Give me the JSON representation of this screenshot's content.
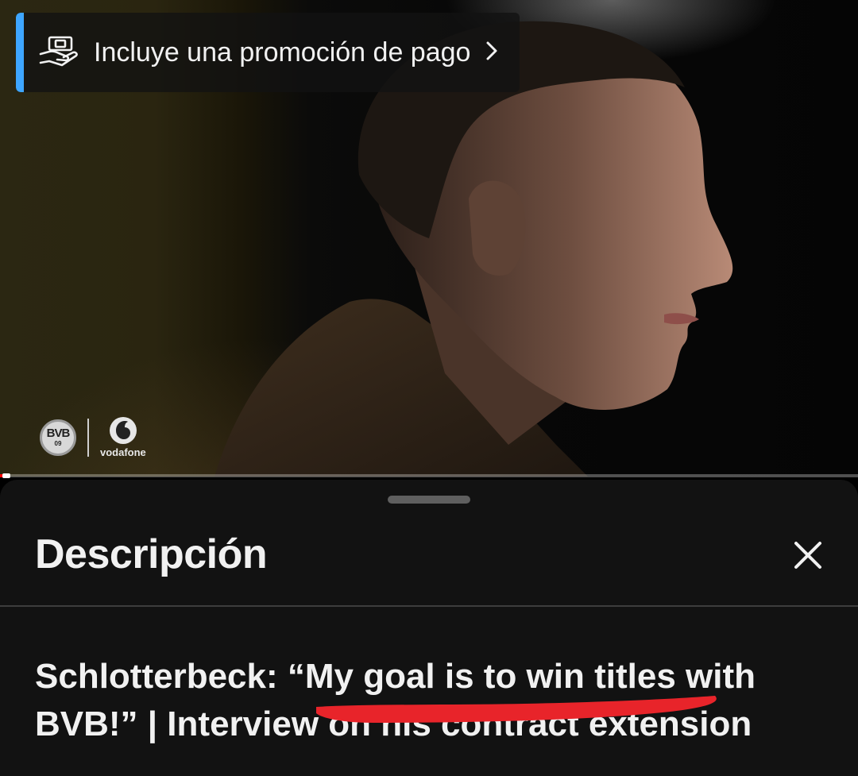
{
  "promo": {
    "label": "Incluye una promoción de pago",
    "icon": "payment-icon",
    "accent_color": "#3ea6ff"
  },
  "video": {
    "watermark": {
      "club_logo": "BVB 09",
      "sponsor": "vodafone"
    },
    "progress_fraction": 0.005
  },
  "description_panel": {
    "title": "Descripción",
    "close_icon": "close-icon",
    "video_title": "Schlotterbeck: “My goal is to win titles with BVB!” | Interview on his contract extension",
    "annotation_color": "#e8242a"
  }
}
